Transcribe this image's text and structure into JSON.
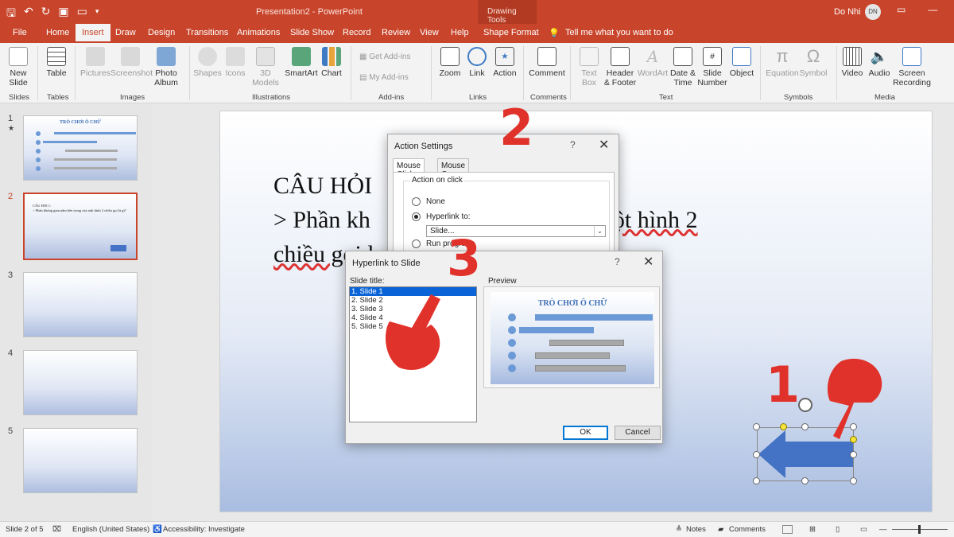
{
  "window": {
    "title": "Presentation2  -  PowerPoint",
    "context_tab": "Drawing Tools",
    "user_name": "Do Nhi",
    "user_initials": "DN"
  },
  "tabs": [
    "File",
    "Home",
    "Insert",
    "Draw",
    "Design",
    "Transitions",
    "Animations",
    "Slide Show",
    "Record",
    "Review",
    "View",
    "Help",
    "Shape Format"
  ],
  "active_tab": "Insert",
  "tell_me": "Tell me what you want to do",
  "ribbon": {
    "new_slide": "New Slide",
    "table": "Table",
    "pictures": "Pictures",
    "screenshot": "Screenshot",
    "photo_album": "Photo Album",
    "shapes": "Shapes",
    "icons": "Icons",
    "models_3d": "3D Models",
    "smartart": "SmartArt",
    "chart": "Chart",
    "get_addins": "Get Add-ins",
    "my_addins": "My Add-ins",
    "zoom": "Zoom",
    "link": "Link",
    "action": "Action",
    "comment": "Comment",
    "text_box": "Text Box",
    "header_footer": "Header & Footer",
    "wordart": "WordArt",
    "date_time": "Date & Time",
    "slide_number": "Slide Number",
    "object": "Object",
    "equation": "Equation",
    "symbol": "Symbol",
    "video": "Video",
    "audio": "Audio",
    "screen_recording": "Screen Recording",
    "groups": {
      "slides": "Slides",
      "tables": "Tables",
      "images": "Images",
      "illustrations": "Illustrations",
      "addins": "Add-ins",
      "links": "Links",
      "comments": "Comments",
      "text": "Text",
      "symbols": "Symbols",
      "media": "Media"
    }
  },
  "thumbnails": {
    "numbers": [
      "1",
      "2",
      "3",
      "4",
      "5"
    ],
    "star": "★",
    "slide1_title": "TRÒ CHƠI Ô CHỮ",
    "slide2_text": "CÂU HỎI 1:\n> Phần không gian nằm bên trong của một hình 2 chiều gọi là gì?"
  },
  "slide": {
    "line1": "CÂU HỎI",
    "line2_a": "> Phần kh",
    "line2_b": "ong của một hình 2",
    "line3": "chiều gọi l"
  },
  "action_settings": {
    "title": "Action Settings",
    "help": "?",
    "close": "✕",
    "tab_click": "Mouse Click",
    "tab_over": "Mouse Over",
    "group_label": "Action on click",
    "opt_none": "None",
    "opt_hyperlink": "Hyperlink to:",
    "hyperlink_value": "Slide...",
    "opt_run": "Run program:"
  },
  "hyperlink_dialog": {
    "title": "Hyperlink to Slide",
    "help": "?",
    "close": "✕",
    "list_label": "Slide title:",
    "slides": [
      "1. Slide 1",
      "2. Slide 2",
      "3. Slide 3",
      "4. Slide 4",
      "5. Slide 5"
    ],
    "selected_index": 0,
    "preview_label": "Preview",
    "preview_title": "TRÒ CHƠI Ô CHỮ",
    "ok": "OK",
    "cancel": "Cancel"
  },
  "annotations": [
    "1",
    "2",
    "3"
  ],
  "status": {
    "slide_info": "Slide 2 of 5",
    "language": "English (United States)",
    "accessibility": "Accessibility: Investigate",
    "notes": "Notes",
    "comments": "Comments"
  },
  "colors": {
    "accent": "#c8452b",
    "selection_blue": "#0a64d8",
    "arrow_fill": "#4472c4",
    "annotation_red": "#e0322a"
  }
}
